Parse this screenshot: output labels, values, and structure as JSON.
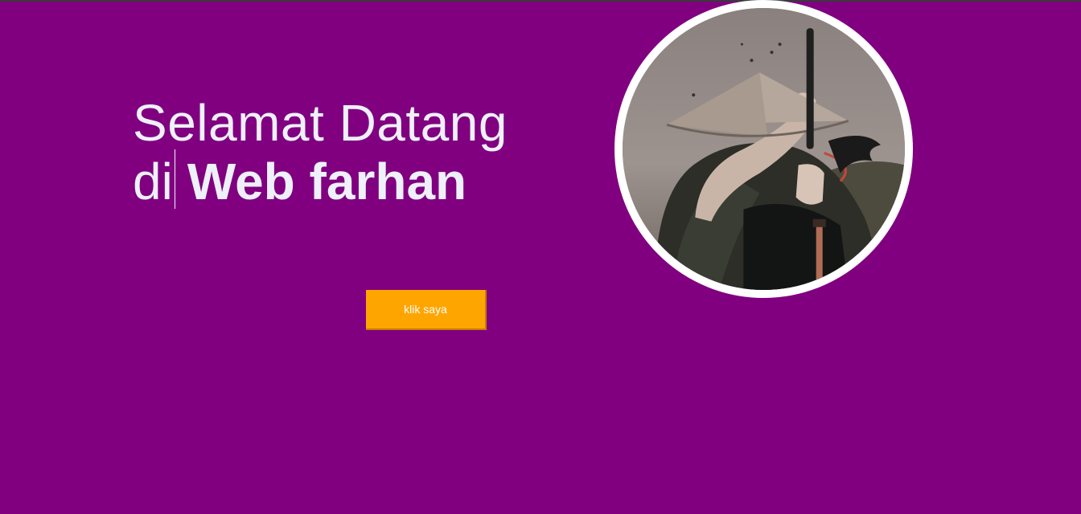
{
  "hero": {
    "line1": "Selamat Datang",
    "line2_prefix": "di",
    "line2_strong": "Web farhan"
  },
  "cta": {
    "label": "klik saya"
  },
  "colors": {
    "background": "#800080",
    "text": "#eef0fa",
    "button": "#ffa500",
    "avatar_border": "#ffffff"
  }
}
